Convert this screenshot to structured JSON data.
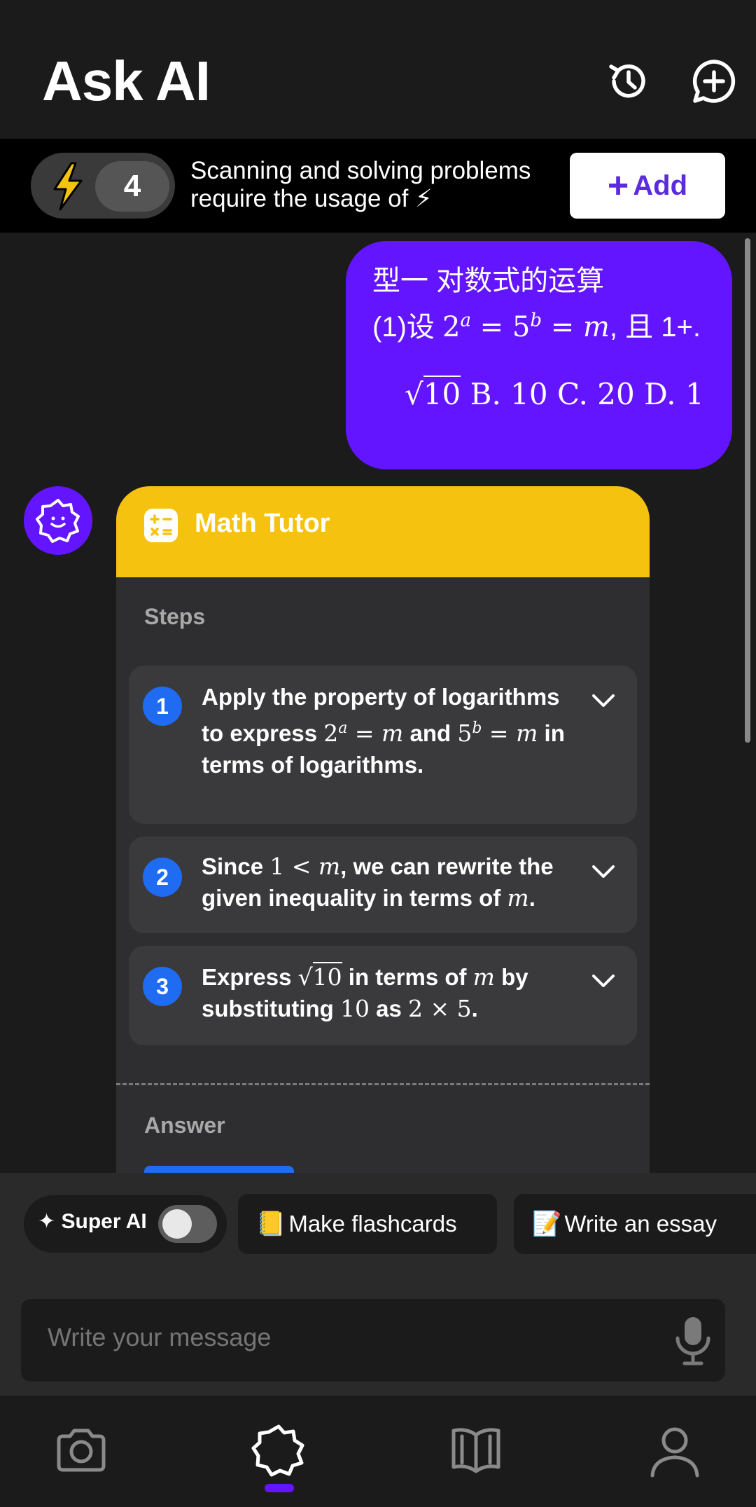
{
  "header": {
    "title": "Ask AI",
    "history_icon": "history-icon",
    "new_chat_icon": "chat-plus-icon"
  },
  "credits": {
    "count": "4",
    "icon": "lightning-bolt-icon",
    "notice": "Scanning and solving problems require the usage of ⚡",
    "add_label": "Add"
  },
  "user_message": {
    "line1": "型一 对数式的运算",
    "line2_prefix": "(1)设 ",
    "line2_tail": ", 且 1+.",
    "line3_root": "10",
    "line3_options": "B. 10 C. 20 D. 1"
  },
  "tutor_card": {
    "title": "Math Tutor",
    "steps_label": "Steps",
    "steps": [
      {
        "number": "1"
      },
      {
        "number": "2"
      },
      {
        "number": "3"
      }
    ],
    "answer_label": "Answer"
  },
  "chips": {
    "super_ai_label": "Super AI",
    "super_ai_enabled": false,
    "flashcards_label": "Make flashcards",
    "flashcards_emoji": "📒",
    "essay_label": "Write an essay",
    "essay_emoji": "📝"
  },
  "composer": {
    "placeholder": "Write your message",
    "mic_icon": "microphone-icon"
  },
  "nav": {
    "items": [
      "camera-icon",
      "ai-badge-icon",
      "book-icon",
      "profile-icon"
    ],
    "active_index": 1
  },
  "colors": {
    "accent_purple": "#6415ff",
    "tutor_yellow": "#f5c20f",
    "step_blue": "#1f6bf2",
    "background": "#1b1b1b"
  }
}
